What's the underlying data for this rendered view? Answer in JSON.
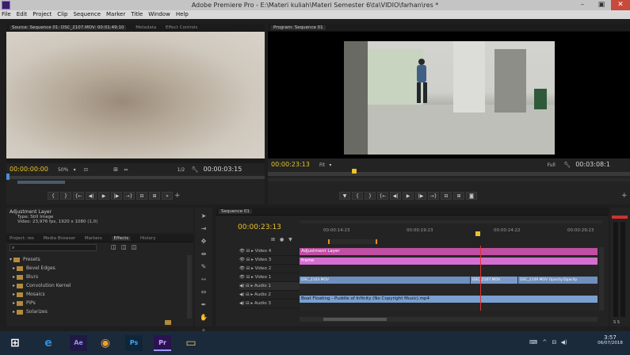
{
  "window": {
    "title": "Adobe Premiere Pro - E:\\Materi kuliah\\Materi Semester 6\\ta\\VIDIO\\farhan\\res *",
    "minimize": "–",
    "maximize": "▣",
    "close": "✕"
  },
  "menu": [
    "File",
    "Edit",
    "Project",
    "Clip",
    "Sequence",
    "Marker",
    "Title",
    "Window",
    "Help"
  ],
  "source_monitor": {
    "tabs": [
      "Source: Sequence 01: DSC_2107.MOV: 00:01:49:10",
      "Metadata",
      "Effect Controls"
    ],
    "timecode_in": "00:00:00:00",
    "zoom": "50%",
    "resolution": "1/2",
    "timecode_out": "00:00:03:15"
  },
  "program_monitor": {
    "tab": "Program: Sequence 01",
    "timecode": "00:00:23:13",
    "fit": "Fit",
    "resolution": "Full",
    "duration": "00:03:08:1"
  },
  "info_panel": {
    "name": "Adjustment Layer",
    "type": "Type: Still Image",
    "video": "Video: 23,976 fps, 1920 x 1080 (1,0)"
  },
  "project_panel": {
    "tabs": [
      "Project: res",
      "Media Browser",
      "Markers",
      "Effects",
      "History"
    ],
    "active_tab": "Effects",
    "items": [
      "Presets",
      "Bevel Edges",
      "Blurs",
      "Convolution Kernel",
      "Mosaics",
      "PiPs",
      "Solarizes"
    ]
  },
  "sequence": {
    "tab": "Sequence 01",
    "timecode": "00:00:23:13",
    "ruler": [
      "00:00:14:23",
      "00:00:19:23",
      "00:00:24:22",
      "00:00:29:23"
    ],
    "tracks": [
      {
        "name": "Video 4",
        "clip": "Adjustment Layer",
        "color": "#c04fa3"
      },
      {
        "name": "Video 3",
        "clip": "frame",
        "color": "#d36fd1"
      },
      {
        "name": "Video 2",
        "clip": "",
        "color": ""
      },
      {
        "name": "Video 1",
        "clip": "DSC_2103.MOV [V]   DSC_2103.MOV Opacity:Opacity ▾",
        "color": "#6e8fbf"
      },
      {
        "name": "Audio 1",
        "clip": "",
        "color": ""
      },
      {
        "name": "Audio 2",
        "clip": "Boat Floating - Puddle of Infinity (No Copyright Music).mp4",
        "color": "#7aa0d1"
      },
      {
        "name": "Audio 3",
        "clip": "",
        "color": ""
      }
    ],
    "video1_clips": [
      "DSC_2103.MOV",
      "DSC_2107.MOV",
      "DSC_2109.MOV Opacity:Opacity"
    ]
  },
  "taskbar": {
    "apps": [
      "Ae",
      "Ps",
      "Pr"
    ],
    "time": "3:57",
    "date": "06/07/2018"
  },
  "colors": {
    "accent_timecode": "#e9c32a",
    "premiere_purple": "#3a1f6a",
    "playhead": "#d33"
  }
}
